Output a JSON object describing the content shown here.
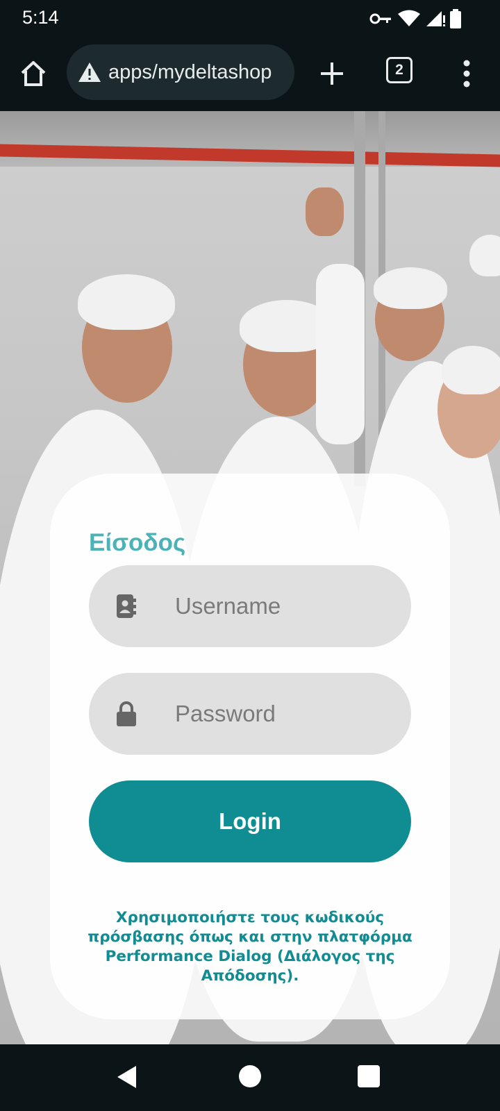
{
  "status_bar": {
    "time": "5:14",
    "icons": [
      "vpn-key-icon",
      "wifi-icon",
      "cell-signal-icon",
      "battery-icon"
    ]
  },
  "browser": {
    "url": "apps/mydeltashop",
    "tab_count": "2",
    "icons": [
      "home-icon",
      "warning-icon",
      "plus-icon",
      "more-vert-icon"
    ]
  },
  "login": {
    "title": "Είσοδος",
    "username_placeholder": "Username",
    "password_placeholder": "Password",
    "login_label": "Login",
    "help_text": "Χρησιμοποιήστε τους κωδικούς πρόσβασης όπως και στην πλατφόρμα Performance Dialog (Διάλογος της Απόδοσης)."
  },
  "colors": {
    "accent": "#108c93",
    "title": "#4bb3b7"
  },
  "nav": {
    "icons": [
      "back-icon",
      "home-circle-icon",
      "recents-icon"
    ]
  }
}
